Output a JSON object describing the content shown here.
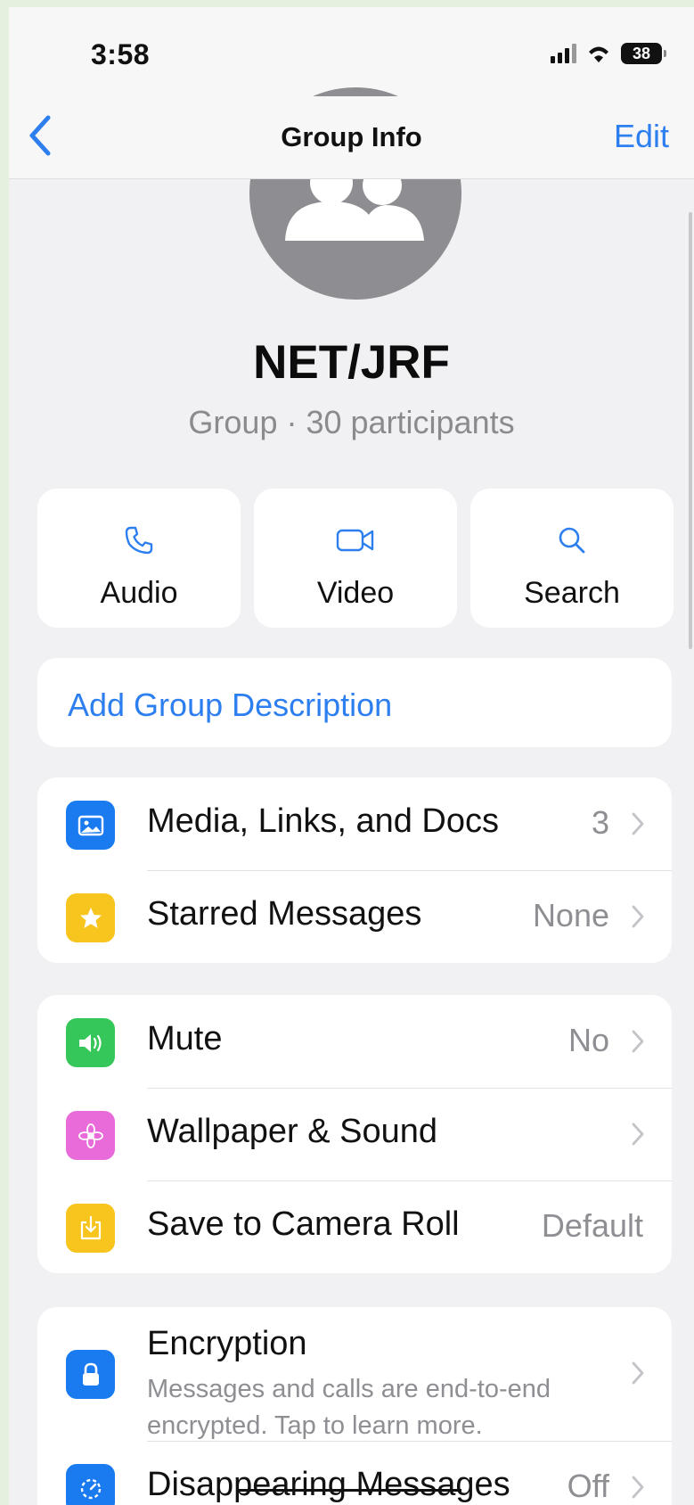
{
  "status_bar": {
    "time": "3:58",
    "battery": "38"
  },
  "nav": {
    "title": "Group Info",
    "edit_label": "Edit"
  },
  "group": {
    "name": "NET/JRF",
    "subtitle": "Group · 30 participants"
  },
  "actions": [
    {
      "label": "Audio",
      "icon": "phone-icon"
    },
    {
      "label": "Video",
      "icon": "video-camera-icon"
    },
    {
      "label": "Search",
      "icon": "search-icon"
    }
  ],
  "description": {
    "label": "Add Group Description"
  },
  "section_media": [
    {
      "label": "Media, Links, and Docs",
      "value": "3",
      "icon": "photo-icon",
      "color": "#1a7af0"
    },
    {
      "label": "Starred Messages",
      "value": "None",
      "icon": "star-icon",
      "color": "#f7c51e"
    }
  ],
  "section_settings": [
    {
      "label": "Mute",
      "value": "No",
      "icon": "speaker-icon",
      "color": "#35c759"
    },
    {
      "label": "Wallpaper & Sound",
      "value": "",
      "icon": "flower-icon",
      "color": "#e86bd9"
    },
    {
      "label": "Save to Camera Roll",
      "value": "Default",
      "icon": "download-icon",
      "color": "#f7c51e"
    }
  ],
  "section_privacy": [
    {
      "label": "Encryption",
      "sub": "Messages and calls are end-to-end encrypted. Tap to learn more.",
      "icon": "lock-icon",
      "color": "#1a7af0"
    },
    {
      "label": "Disappearing Messages",
      "value": "Off",
      "icon": "timer-icon",
      "color": "#1a7af0"
    }
  ],
  "colors": {
    "accent": "#2d7ff0",
    "background": "#f1f1f3",
    "card": "#ffffff",
    "secondary_text": "#8e8e93"
  }
}
